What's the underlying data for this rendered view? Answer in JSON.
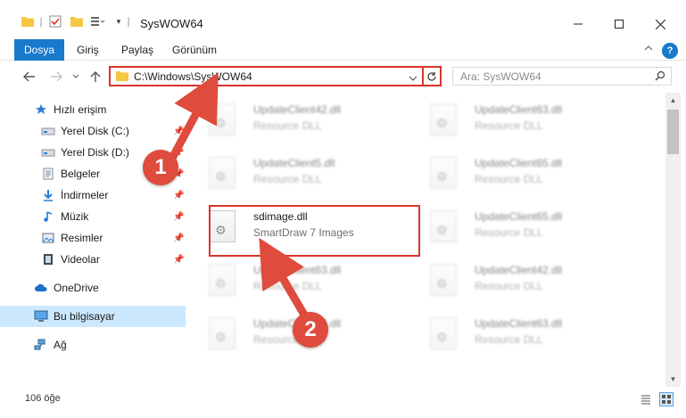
{
  "window": {
    "title": "SysWOW64"
  },
  "ribbon": {
    "tabs": [
      {
        "label": "Dosya"
      },
      {
        "label": "Giriş"
      },
      {
        "label": "Paylaş"
      },
      {
        "label": "Görünüm"
      }
    ],
    "help_label": "?"
  },
  "address": {
    "path": "C:\\Windows\\SysWOW64"
  },
  "search": {
    "placeholder": "Ara: SysWOW64"
  },
  "sidebar": {
    "items": [
      {
        "label": "Hızlı erişim",
        "icon": "star-icon"
      },
      {
        "label": "Yerel Disk (C:)",
        "icon": "drive-icon"
      },
      {
        "label": "Yerel Disk (D:)",
        "icon": "drive-icon"
      },
      {
        "label": "Belgeler",
        "icon": "documents-icon"
      },
      {
        "label": "İndirmeler",
        "icon": "downloads-icon"
      },
      {
        "label": "Müzik",
        "icon": "music-icon"
      },
      {
        "label": "Resimler",
        "icon": "pictures-icon"
      },
      {
        "label": "Videolar",
        "icon": "videos-icon"
      },
      {
        "label": "OneDrive",
        "icon": "cloud-icon"
      },
      {
        "label": "Bu bilgisayar",
        "icon": "computer-icon"
      },
      {
        "label": "Ağ",
        "icon": "network-icon"
      }
    ]
  },
  "files": [
    {
      "name": "UpdateClient42.dll",
      "desc": "Resource DLL"
    },
    {
      "name": "UpdateClient63.dll",
      "desc": "Resource DLL"
    },
    {
      "name": "UpdateClient5.dll",
      "desc": "Resource DLL"
    },
    {
      "name": "UpdateClient65.dll",
      "desc": "Resource DLL"
    },
    {
      "name": "sdimage.dll",
      "desc": "SmartDraw 7 Images"
    },
    {
      "name": "UpdateClient65.dll",
      "desc": "Resource DLL"
    },
    {
      "name": "UpdateClient63.dll",
      "desc": "Resource DLL"
    },
    {
      "name": "UpdateClient42.dll",
      "desc": "Resource DLL"
    },
    {
      "name": "UpdateClient65.dll",
      "desc": "Resource DLL"
    },
    {
      "name": "UpdateClient63.dll",
      "desc": "Resource DLL"
    }
  ],
  "status": {
    "count": "106 öğe"
  },
  "annotations": {
    "step1": "1",
    "step2": "2",
    "color": "#df4b3c"
  }
}
